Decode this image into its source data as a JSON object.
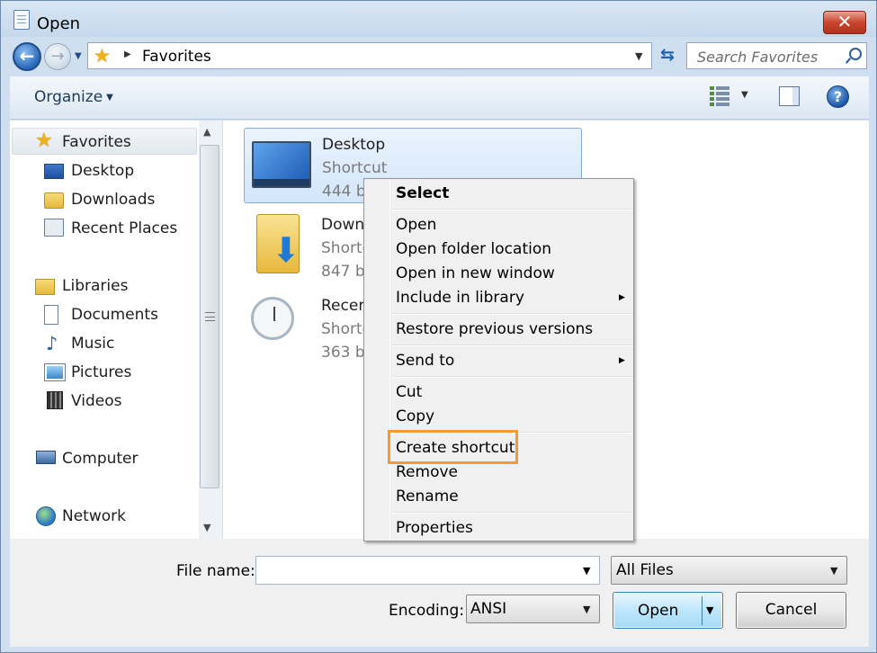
{
  "window": {
    "title": "Open",
    "close_glyph": "✕"
  },
  "nav": {
    "back_glyph": "←",
    "forward_glyph": "→",
    "refresh_glyph": "⇆"
  },
  "address": {
    "location": "Favorites"
  },
  "search": {
    "placeholder": "Search Favorites"
  },
  "toolbar": {
    "organize_label": "Organize",
    "help_glyph": "?"
  },
  "sidebar": {
    "favorites": "Favorites",
    "desktop": "Desktop",
    "downloads": "Downloads",
    "recent_places": "Recent Places",
    "libraries": "Libraries",
    "documents": "Documents",
    "music": "Music",
    "pictures": "Pictures",
    "videos": "Videos",
    "computer": "Computer",
    "network": "Network"
  },
  "files": [
    {
      "name": "Desktop",
      "type": "Shortcut",
      "size": "444 b",
      "icon": "desktop-shortcut-icon",
      "selected": true
    },
    {
      "name": "Down",
      "type": "Shorte",
      "size": "847 b",
      "icon": "downloads-folder-icon",
      "selected": false
    },
    {
      "name": "Recen",
      "type": "Shorte",
      "size": "363 b",
      "icon": "recent-places-icon",
      "selected": false
    }
  ],
  "context_menu": {
    "select": "Select",
    "open": "Open",
    "open_folder_location": "Open folder location",
    "open_new_window": "Open in new window",
    "include_library": "Include in library",
    "restore_versions": "Restore previous versions",
    "send_to": "Send to",
    "cut": "Cut",
    "copy": "Copy",
    "create_shortcut": "Create shortcut",
    "remove": "Remove",
    "rename": "Rename",
    "properties": "Properties",
    "highlight_color": "#f39a36"
  },
  "footer": {
    "file_name_label": "File name:",
    "file_name_value": "",
    "filter_value": "All Files",
    "encoding_label": "Encoding:",
    "encoding_value": "ANSI",
    "open_label": "Open",
    "cancel_label": "Cancel"
  }
}
